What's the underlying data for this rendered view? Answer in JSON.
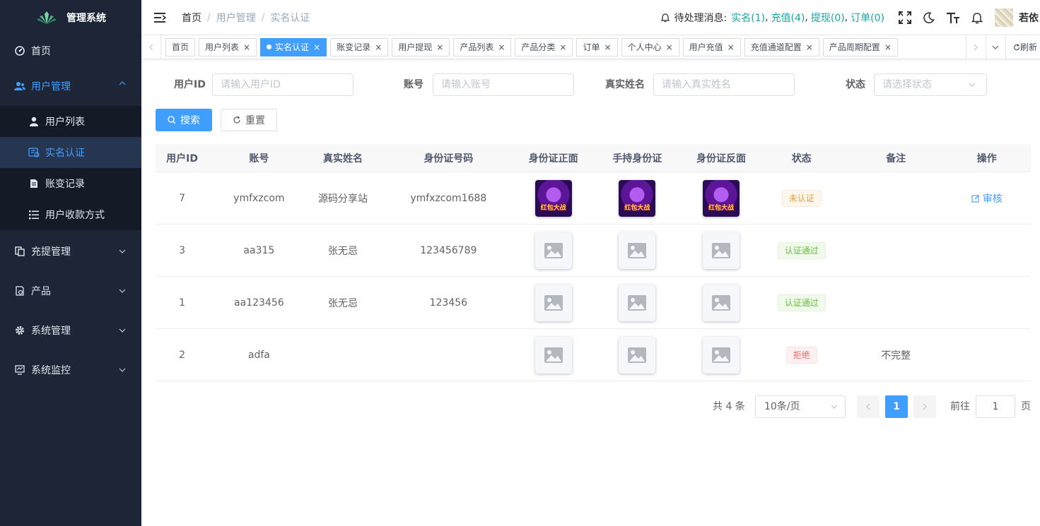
{
  "app": {
    "title": "管理系统"
  },
  "sidebar": {
    "items": [
      {
        "label": "首页",
        "icon": "dashboard-icon"
      },
      {
        "label": "用户管理",
        "icon": "user-group-icon",
        "expanded": true,
        "children": [
          {
            "label": "用户列表",
            "icon": "user-icon"
          },
          {
            "label": "实名认证",
            "icon": "id-card-icon",
            "active": true
          },
          {
            "label": "账变记录",
            "icon": "document-icon"
          },
          {
            "label": "用户收款方式",
            "icon": "list-icon"
          }
        ]
      },
      {
        "label": "充提管理",
        "icon": "wallet-icon"
      },
      {
        "label": "产品",
        "icon": "product-icon"
      },
      {
        "label": "系统管理",
        "icon": "gear-icon"
      },
      {
        "label": "系统监控",
        "icon": "monitor-icon"
      }
    ]
  },
  "navbar": {
    "breadcrumb": [
      "首页",
      "用户管理",
      "实名认证"
    ],
    "pending_label": "待处理消息:",
    "pending": [
      {
        "label": "实名(1)"
      },
      {
        "label": "充值(4)"
      },
      {
        "label": "提现(0)"
      },
      {
        "label": "订单(0)"
      }
    ],
    "username": "若依"
  },
  "tags": [
    {
      "label": "首页",
      "closable": false
    },
    {
      "label": "用户列表",
      "closable": true
    },
    {
      "label": "实名认证",
      "closable": true,
      "active": true
    },
    {
      "label": "账变记录",
      "closable": true
    },
    {
      "label": "用户提现",
      "closable": true
    },
    {
      "label": "产品列表",
      "closable": true
    },
    {
      "label": "产品分类",
      "closable": true
    },
    {
      "label": "订单",
      "closable": true
    },
    {
      "label": "个人中心",
      "closable": true
    },
    {
      "label": "用户充值",
      "closable": true
    },
    {
      "label": "充值通道配置",
      "closable": true
    },
    {
      "label": "产品周期配置",
      "closable": true
    }
  ],
  "tags_refresh": "刷新",
  "form": {
    "user_id": {
      "label": "用户ID",
      "placeholder": "请输入用户ID"
    },
    "account": {
      "label": "账号",
      "placeholder": "请输入账号"
    },
    "real_name": {
      "label": "真实姓名",
      "placeholder": "请输入真实姓名"
    },
    "status": {
      "label": "状态",
      "placeholder": "请选择状态"
    },
    "search_label": "搜索",
    "reset_label": "重置"
  },
  "table": {
    "headers": [
      "用户ID",
      "账号",
      "真实姓名",
      "身份证号码",
      "身份证正面",
      "手持身份证",
      "身份证反面",
      "状态",
      "备注",
      "操作"
    ],
    "game_image_text": "红包大战",
    "rows": [
      {
        "id": "7",
        "account": "ymfxzcom",
        "name": "源码分享站",
        "card": "ymfxzcom1688",
        "images": "game",
        "status": "未认证",
        "status_type": "warn",
        "remark": "",
        "action": "审核"
      },
      {
        "id": "3",
        "account": "aa315",
        "name": "张无忌",
        "card": "123456789",
        "images": "placeholder",
        "status": "认证通过",
        "status_type": "ok",
        "remark": "",
        "action": ""
      },
      {
        "id": "1",
        "account": "aa123456",
        "name": "张无忌",
        "card": "123456",
        "images": "placeholder",
        "status": "认证通过",
        "status_type": "ok",
        "remark": "",
        "action": ""
      },
      {
        "id": "2",
        "account": "adfa",
        "name": "",
        "card": "",
        "images": "placeholder",
        "status": "拒绝",
        "status_type": "err",
        "remark": "不完整",
        "action": ""
      }
    ]
  },
  "pagination": {
    "total": "共 4 条",
    "page_size": "10条/页",
    "current": "1",
    "goto_label": "前往",
    "goto_value": "1",
    "page_suffix": "页"
  },
  "colors": {
    "primary": "#409eff",
    "sidebar_bg": "#1d2536",
    "link_teal": "#13a7a7"
  }
}
